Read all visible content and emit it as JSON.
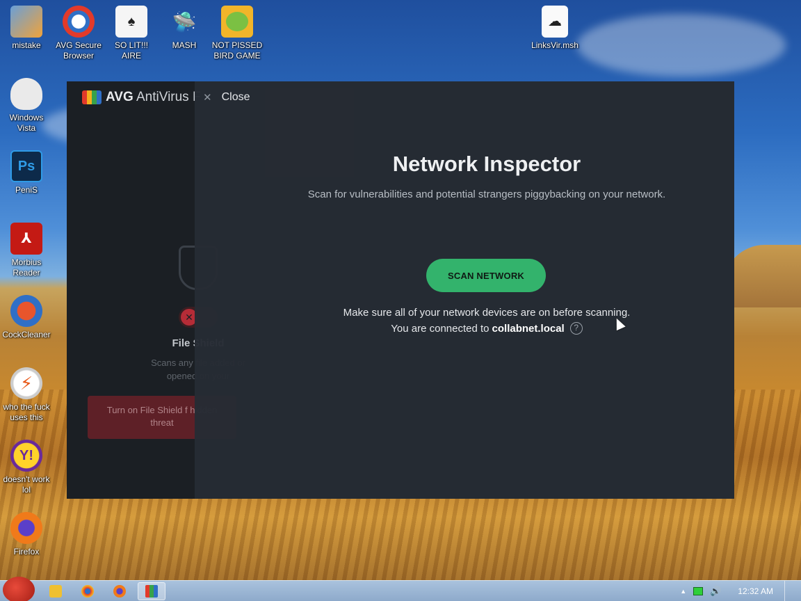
{
  "desktop": {
    "icons": [
      {
        "label": "mistake",
        "icon": "computer-icon"
      },
      {
        "label": "AVG Secure Browser",
        "icon": "avg-browser-icon"
      },
      {
        "label": "SO LIT!!! AIRE",
        "icon": "solitaire-icon"
      },
      {
        "label": "MASH",
        "icon": "mash-icon"
      },
      {
        "label": "NOT PISSED BIRD GAME",
        "icon": "bird-game-icon"
      },
      {
        "label": "LinksVir.msh",
        "icon": "file-icon"
      },
      {
        "label": "Windows Vista",
        "icon": "vista-icon"
      },
      {
        "label": "PeniS",
        "icon": "photoshop-icon"
      },
      {
        "label": "Morbius Reader",
        "icon": "pdf-reader-icon"
      },
      {
        "label": "CockCleaner",
        "icon": "cleaner-icon"
      },
      {
        "label": "who the fuck uses this",
        "icon": "flash-icon"
      },
      {
        "label": "doesn't work lol",
        "icon": "yahoo-messenger-icon"
      },
      {
        "label": "Firefox",
        "icon": "firefox-icon"
      }
    ]
  },
  "avg": {
    "title_brand": "AVG",
    "title_rest": "AntiVirus F",
    "file_shield": {
      "title": "File Shield",
      "description": "Scans any file added or opened on your",
      "warning": "Turn on File Shield f hidden threat"
    }
  },
  "modal": {
    "close_label": "Close",
    "title": "Network Inspector",
    "subtitle": "Scan for vulnerabilities and potential strangers piggybacking on your network.",
    "scan_button": "SCAN NETWORK",
    "hint_line1": "Make sure all of your network devices are on before scanning.",
    "hint_line2_prefix": "You are connected to",
    "network_name": "collabnet.local",
    "help_symbol": "?"
  },
  "taskbar": {
    "clock": "12:32 AM",
    "tray_arrow": "▲"
  }
}
